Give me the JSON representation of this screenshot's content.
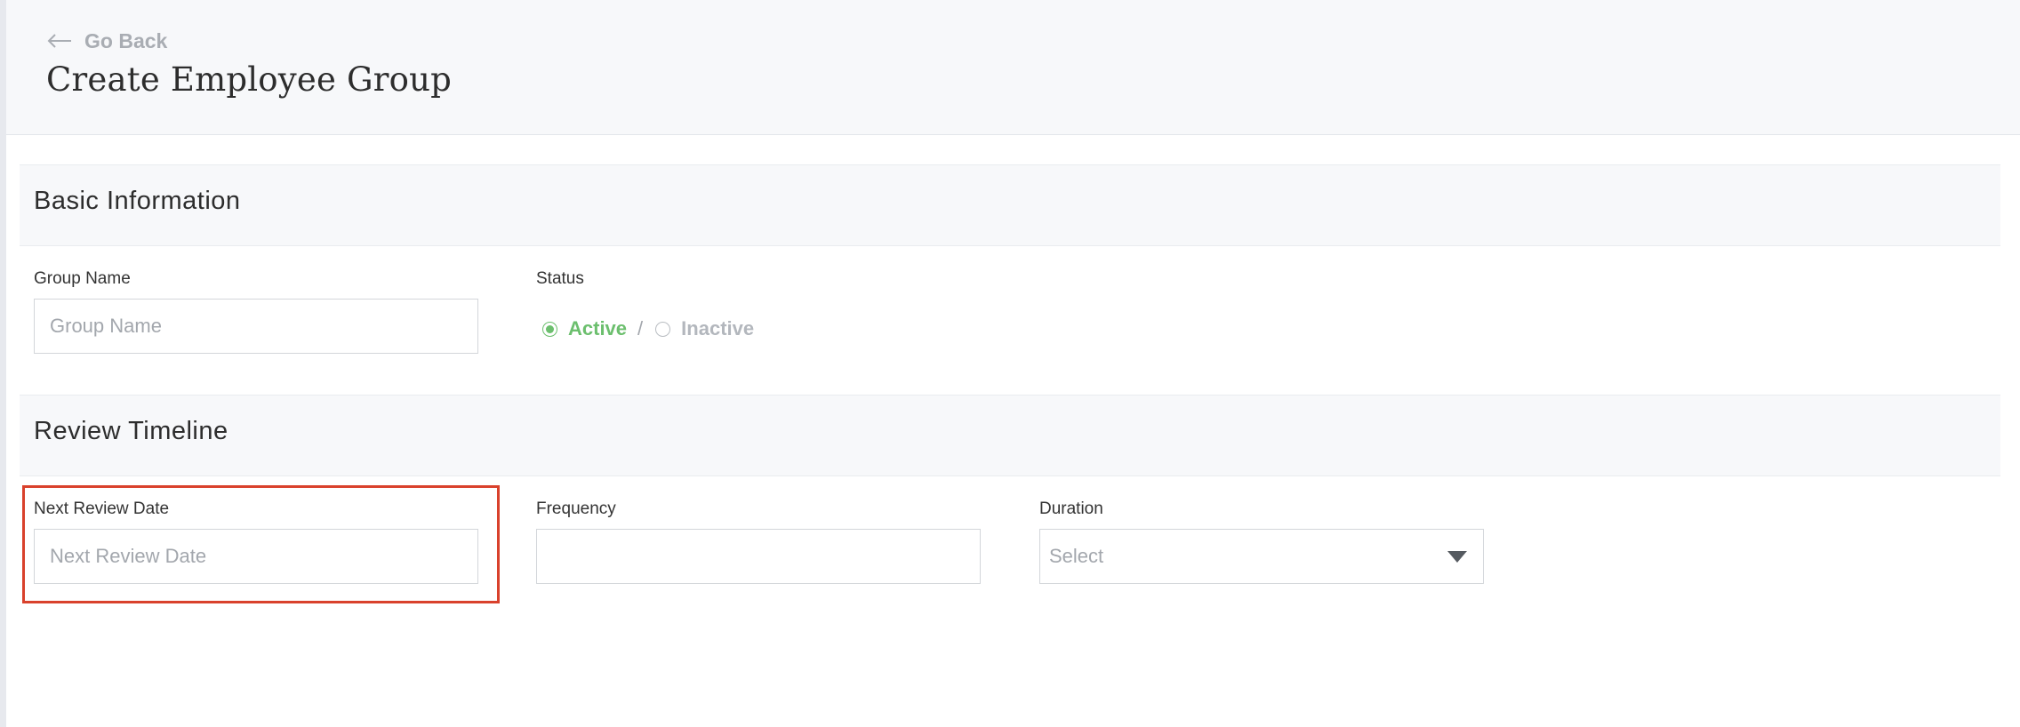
{
  "header": {
    "back_label": "Go Back",
    "title": "Create Employee Group"
  },
  "basic_info": {
    "title": "Basic Information",
    "group_name": {
      "label": "Group Name",
      "placeholder": "Group Name",
      "value": ""
    },
    "status": {
      "label": "Status",
      "options": [
        "Active",
        "Inactive"
      ],
      "selected": "Active",
      "separator": "/"
    }
  },
  "review_timeline": {
    "title": "Review Timeline",
    "next_review_date": {
      "label": "Next Review Date",
      "placeholder": "Next Review Date",
      "value": ""
    },
    "frequency": {
      "label": "Frequency",
      "value": ""
    },
    "duration": {
      "label": "Duration",
      "selected": "Select"
    }
  },
  "colors": {
    "accent_green": "#6cbf6e",
    "highlight_red": "#d9412c",
    "band_background": "#f7f8fa"
  },
  "icons": {
    "back": "arrow-left-icon",
    "dropdown": "caret-down-icon"
  }
}
